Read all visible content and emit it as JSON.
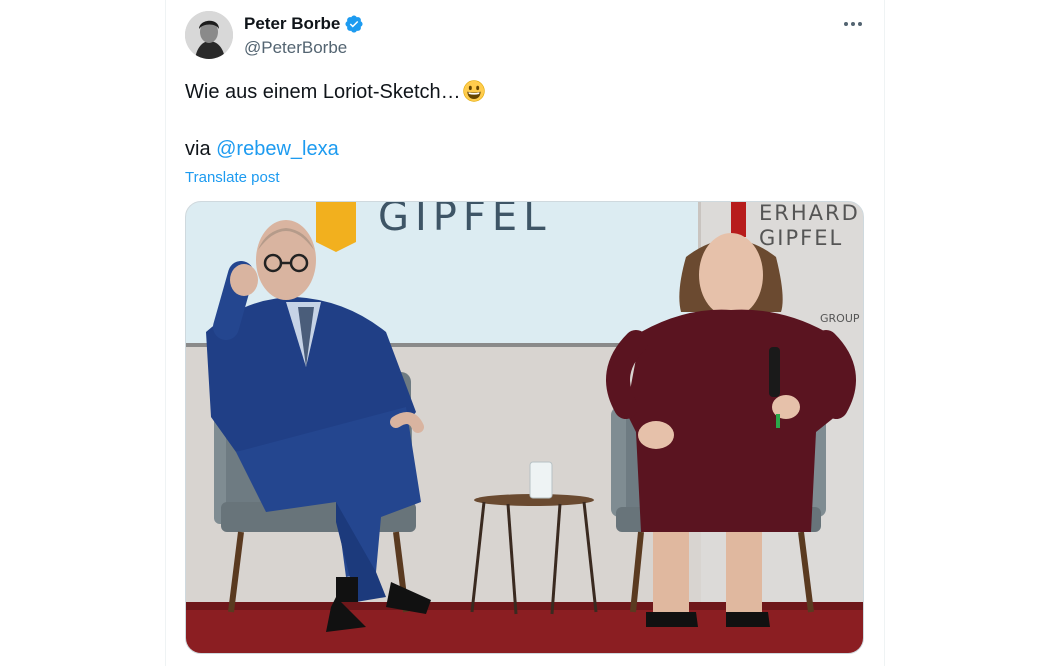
{
  "post": {
    "author_name": "Peter Borbe",
    "author_handle": "@PeterBorbe",
    "text": "Wie aus einem Loriot-Sketch…",
    "via_prefix": "via ",
    "via_mention": "@rebew_lexa",
    "translate_label": "Translate post"
  },
  "media": {
    "stage_sign_main": "GIPFEL",
    "stage_sign_right_line1": "ERHARD",
    "stage_sign_right_line2": "GIPFEL",
    "stage_sign_right_group": "GROUP"
  },
  "icons": {
    "verified": "verified-badge-icon",
    "more": "more-options-icon",
    "emoji": "grinning-face-emoji"
  },
  "colors": {
    "accent": "#1d9bf0",
    "text_primary": "#0f1419",
    "text_secondary": "#536471"
  }
}
